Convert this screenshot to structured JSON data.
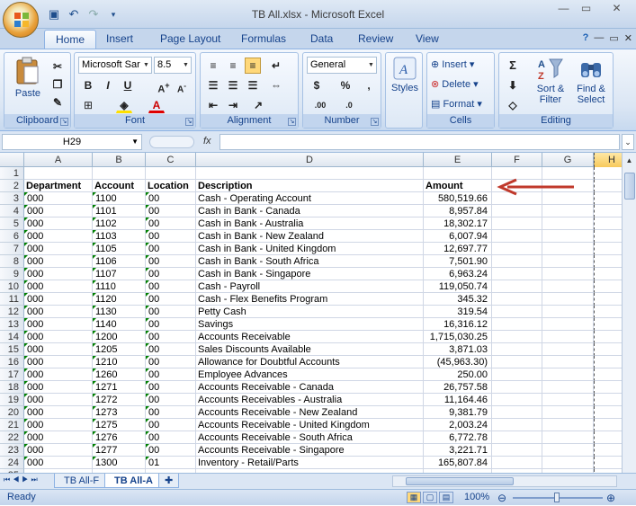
{
  "window": {
    "title": "TB All.xlsx - Microsoft Excel"
  },
  "ribbon": {
    "tabs": [
      "Home",
      "Insert",
      "Page Layout",
      "Formulas",
      "Data",
      "Review",
      "View"
    ],
    "clipboard": {
      "label": "Clipboard",
      "paste": "Paste"
    },
    "font": {
      "label": "Font",
      "name": "Microsoft Sar",
      "size": "8.5"
    },
    "alignment": {
      "label": "Alignment"
    },
    "number": {
      "label": "Number",
      "format": "General"
    },
    "styles": {
      "label": "Styles"
    },
    "cells": {
      "label": "Cells",
      "insert": "Insert",
      "delete": "Delete",
      "format": "Format"
    },
    "editing": {
      "label": "Editing",
      "sort": "Sort &",
      "filter": "Filter",
      "find": "Find &",
      "select": "Select"
    }
  },
  "formula_bar": {
    "name_box": "H29",
    "fx": "fx",
    "formula": ""
  },
  "columns": [
    "A",
    "B",
    "C",
    "D",
    "E",
    "F",
    "G",
    "H"
  ],
  "rows": [
    {
      "n": "1",
      "a": "",
      "b": "",
      "c": "",
      "d": "",
      "e": ""
    },
    {
      "n": "2",
      "a": "Department",
      "b": "Account",
      "c": "Location",
      "d": "Description",
      "e": "Amount",
      "hdr": true
    },
    {
      "n": "3",
      "a": "000",
      "b": "1100",
      "c": "00",
      "d": "Cash - Operating Account",
      "e": "580,519.66"
    },
    {
      "n": "4",
      "a": "000",
      "b": "1101",
      "c": "00",
      "d": "Cash in Bank - Canada",
      "e": "8,957.84"
    },
    {
      "n": "5",
      "a": "000",
      "b": "1102",
      "c": "00",
      "d": "Cash in Bank - Australia",
      "e": "18,302.17"
    },
    {
      "n": "6",
      "a": "000",
      "b": "1103",
      "c": "00",
      "d": "Cash in Bank - New Zealand",
      "e": "6,007.94"
    },
    {
      "n": "7",
      "a": "000",
      "b": "1105",
      "c": "00",
      "d": "Cash in Bank - United Kingdom",
      "e": "12,697.77"
    },
    {
      "n": "8",
      "a": "000",
      "b": "1106",
      "c": "00",
      "d": "Cash in Bank - South Africa",
      "e": "7,501.90"
    },
    {
      "n": "9",
      "a": "000",
      "b": "1107",
      "c": "00",
      "d": "Cash in Bank - Singapore",
      "e": "6,963.24"
    },
    {
      "n": "10",
      "a": "000",
      "b": "1110",
      "c": "00",
      "d": "Cash - Payroll",
      "e": "119,050.74"
    },
    {
      "n": "11",
      "a": "000",
      "b": "1120",
      "c": "00",
      "d": "Cash - Flex Benefits Program",
      "e": "345.32"
    },
    {
      "n": "12",
      "a": "000",
      "b": "1130",
      "c": "00",
      "d": "Petty Cash",
      "e": "319.54"
    },
    {
      "n": "13",
      "a": "000",
      "b": "1140",
      "c": "00",
      "d": "Savings",
      "e": "16,316.12"
    },
    {
      "n": "14",
      "a": "000",
      "b": "1200",
      "c": "00",
      "d": "Accounts Receivable",
      "e": "1,715,030.25"
    },
    {
      "n": "15",
      "a": "000",
      "b": "1205",
      "c": "00",
      "d": "Sales Discounts Available",
      "e": "3,871.03"
    },
    {
      "n": "16",
      "a": "000",
      "b": "1210",
      "c": "00",
      "d": "Allowance for Doubtful Accounts",
      "e": "(45,963.30)"
    },
    {
      "n": "17",
      "a": "000",
      "b": "1260",
      "c": "00",
      "d": "Employee Advances",
      "e": "250.00"
    },
    {
      "n": "18",
      "a": "000",
      "b": "1271",
      "c": "00",
      "d": "Accounts Receivable - Canada",
      "e": "26,757.58"
    },
    {
      "n": "19",
      "a": "000",
      "b": "1272",
      "c": "00",
      "d": "Accounts Receivables - Australia",
      "e": "11,164.46"
    },
    {
      "n": "20",
      "a": "000",
      "b": "1273",
      "c": "00",
      "d": "Accounts Receivable - New Zealand",
      "e": "9,381.79"
    },
    {
      "n": "21",
      "a": "000",
      "b": "1275",
      "c": "00",
      "d": "Accounts Receivable - United Kingdom",
      "e": "2,003.24"
    },
    {
      "n": "22",
      "a": "000",
      "b": "1276",
      "c": "00",
      "d": "Accounts Receivable - South Africa",
      "e": "6,772.78"
    },
    {
      "n": "23",
      "a": "000",
      "b": "1277",
      "c": "00",
      "d": "Accounts Receivable - Singapore",
      "e": "3,221.71"
    },
    {
      "n": "24",
      "a": "000",
      "b": "1300",
      "c": "01",
      "d": "Inventory - Retail/Parts",
      "e": "165,807.84"
    },
    {
      "n": "25",
      "a": "",
      "b": "",
      "c": "",
      "d": "",
      "e": ""
    }
  ],
  "sheets": [
    "TB All-F",
    "TB All-A"
  ],
  "status": {
    "text": "Ready",
    "zoom": "100%"
  },
  "colors": {
    "arrow": "#c0392b",
    "accent": "#15428b",
    "triangle": "#008000"
  }
}
